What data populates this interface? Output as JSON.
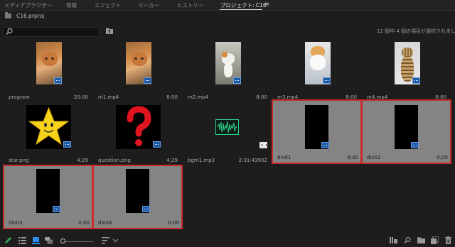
{
  "tabs": [
    {
      "label": "メディアブラウザー",
      "active": false
    },
    {
      "label": "情報",
      "active": false
    },
    {
      "label": "エフェクト",
      "active": false
    },
    {
      "label": "マーカー",
      "active": false
    },
    {
      "label": "ヒストリー",
      "active": false
    },
    {
      "label": "プロジェクト: C16",
      "active": true
    }
  ],
  "tab_menu_glyph": "≡",
  "project": {
    "name": "C16.prproj"
  },
  "search": {
    "value": "",
    "placeholder": ""
  },
  "status_text": "12 個中 4 個の項目が選択されまし",
  "items": [
    {
      "name": "program",
      "duration": "20:00",
      "thumb": "cat-orange",
      "badge": "video",
      "selected": false
    },
    {
      "name": "m1.mp4",
      "duration": "8:00",
      "thumb": "cat-orange",
      "badge": "video",
      "selected": false
    },
    {
      "name": "m2.mp4",
      "duration": "8:00",
      "thumb": "kitten-walk",
      "badge": "video",
      "selected": false
    },
    {
      "name": "m3.mp4",
      "duration": "8:00",
      "thumb": "kitten-white",
      "badge": "video",
      "selected": false
    },
    {
      "name": "m4.mp4",
      "duration": "8:00",
      "thumb": "cat-tabby",
      "badge": "video",
      "selected": false
    },
    {
      "name": "star.png",
      "duration": "4;29",
      "thumb": "star",
      "badge": "video",
      "selected": false
    },
    {
      "name": "question.png",
      "duration": "4;29",
      "thumb": "question",
      "badge": "video",
      "selected": false
    },
    {
      "name": "bgm1.mp3",
      "duration": "2:31:43902",
      "thumb": "audio-wave",
      "badge": "audio",
      "selected": false
    },
    {
      "name": "div01",
      "duration": "0;00",
      "thumb": "black",
      "badge": "sequence",
      "selected": true
    },
    {
      "name": "div02",
      "duration": "0;00",
      "thumb": "black",
      "badge": "sequence",
      "selected": true
    },
    {
      "name": "div03",
      "duration": "0;00",
      "thumb": "black",
      "badge": "sequence",
      "selected": true
    },
    {
      "name": "div04",
      "duration": "0;00",
      "thumb": "black",
      "badge": "sequence",
      "selected": true
    }
  ],
  "colors": {
    "selection_outline": "#c92a2a",
    "selected_bg": "#848484",
    "badge_blue": "#1f5aa8",
    "audio_green": "#2fd18a",
    "active_view": "#2d8ceb"
  },
  "bottom_icons_left": [
    "pencil-icon",
    "list-view-icon",
    "icon-view-icon",
    "freeform-view-icon",
    "zoom-slider",
    "sort-icon",
    "chevron-down-icon"
  ],
  "bottom_icons_right": [
    "automate-to-sequence-icon",
    "find-icon",
    "new-bin-icon",
    "new-item-icon",
    "trash-icon"
  ]
}
